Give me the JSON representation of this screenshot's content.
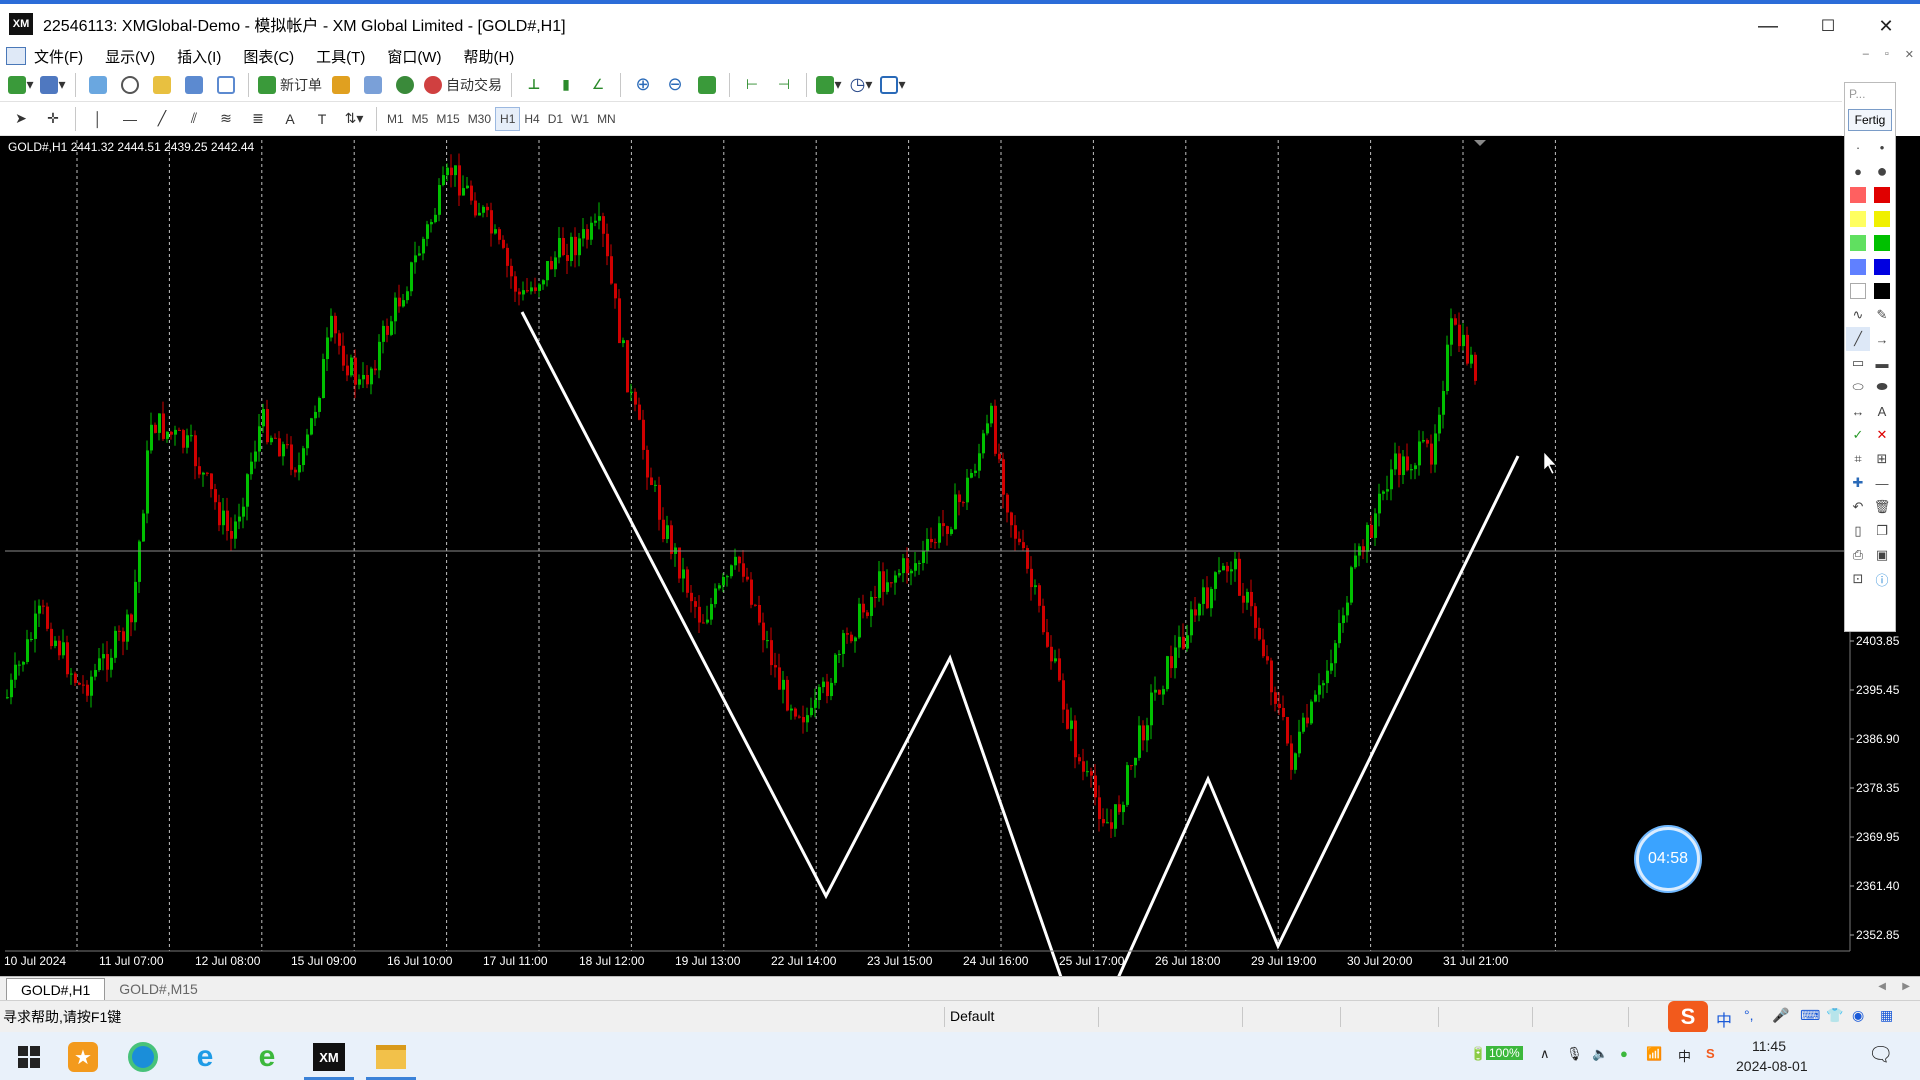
{
  "window": {
    "title": "22546113: XMGlobal-Demo - 模拟帐户 - XM Global Limited - [GOLD#,H1]",
    "logo_text": "XM",
    "minimize_icon": "—",
    "maximize_icon": "☐",
    "close_icon": "✕"
  },
  "menu": {
    "items": [
      "文件(F)",
      "显示(V)",
      "插入(I)",
      "图表(C)",
      "工具(T)",
      "窗口(W)",
      "帮助(H)"
    ]
  },
  "toolbar": {
    "new_order_label": "新订单",
    "auto_trading_label": "自动交易",
    "timeframes": [
      "M1",
      "M5",
      "M15",
      "M30",
      "H1",
      "H4",
      "D1",
      "W1",
      "MN"
    ],
    "active_timeframe": "H1"
  },
  "chart": {
    "info": "GOLD#,H1  2441.32 2444.51 2439.25 2442.44",
    "price_labels": [
      "2403.85",
      "2395.45",
      "2386.90",
      "2378.35",
      "2369.95",
      "2361.40",
      "2352.85"
    ],
    "time_labels": [
      "10 Jul 2024",
      "11 Jul 07:00",
      "12 Jul 08:00",
      "15 Jul 09:00",
      "16 Jul 10:00",
      "17 Jul 11:00",
      "18 Jul 12:00",
      "19 Jul 13:00",
      "22 Jul 14:00",
      "23 Jul 15:00",
      "24 Jul 16:00",
      "25 Jul 17:00",
      "26 Jul 18:00",
      "29 Jul 19:00",
      "30 Jul 20:00",
      "31 Jul 21:00"
    ],
    "colors": {
      "bull": "#00c000",
      "bear": "#d00000",
      "grid": "#c0c0c0",
      "zigzag": "#ffffff"
    }
  },
  "palette": {
    "title": "P...",
    "done_label": "Fertig",
    "colors": [
      "#ff3030",
      "#e00000",
      "#ffff40",
      "#f0f000",
      "#40e040",
      "#00c000",
      "#4060ff",
      "#0000e0",
      "#ffffff",
      "#000000"
    ]
  },
  "countdown": {
    "time": "04:58"
  },
  "tabs": {
    "items": [
      "GOLD#,H1",
      "GOLD#,M15"
    ],
    "active": "GOLD#,H1"
  },
  "status": {
    "help_text": "寻求帮助,请按F1键",
    "profile": "Default"
  },
  "taskbar": {
    "battery": "100%",
    "time": "11:45",
    "date": "2024-08-01",
    "ime_text": "中"
  }
}
